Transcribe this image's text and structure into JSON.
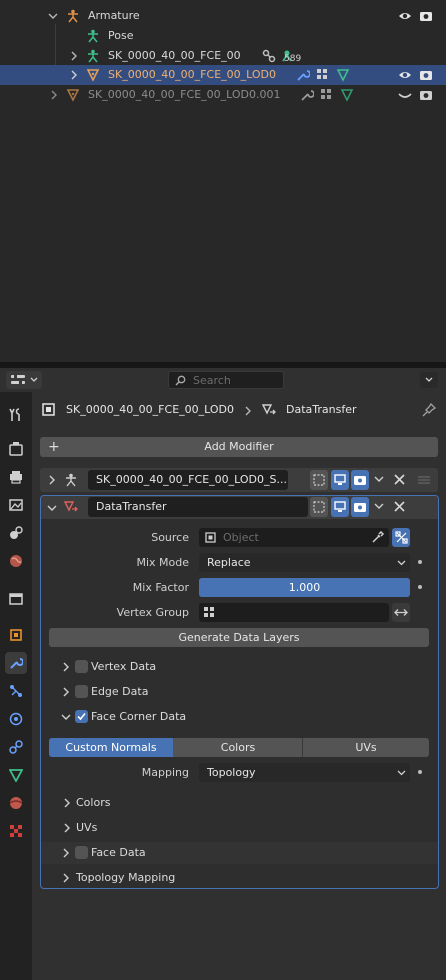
{
  "outliner": {
    "rows": [
      {
        "label": "Armature"
      },
      {
        "label": "Pose"
      },
      {
        "label": "SK_0000_40_00_FCE_00",
        "badge": "589"
      },
      {
        "label": "SK_0000_40_00_FCE_00_LOD0"
      },
      {
        "label": "SK_0000_40_00_FCE_00_LOD0.001"
      }
    ]
  },
  "header": {
    "search_placeholder": "Search"
  },
  "breadcrumb": {
    "object": "SK_0000_40_00_FCE_00_LOD0",
    "modifier": "DataTransfer"
  },
  "add_modifier": "Add Modifier",
  "modifiers": {
    "first": {
      "name": "SK_0000_40_00_FCE_00_LOD0_S..."
    },
    "second": {
      "name": "DataTransfer"
    }
  },
  "data_transfer": {
    "source_label": "Source",
    "source_placeholder": "Object",
    "mix_mode_label": "Mix Mode",
    "mix_mode_value": "Replace",
    "mix_factor_label": "Mix Factor",
    "mix_factor_value": "1.000",
    "mix_factor_fraction": 1.0,
    "vertex_group_label": "Vertex Group",
    "generate_button": "Generate Data Layers",
    "sections": {
      "vertex_data": "Vertex Data",
      "edge_data": "Edge Data",
      "face_corner_data": "Face Corner Data",
      "face_data": "Face Data",
      "topology_mapping": "Topology Mapping"
    },
    "face_corner": {
      "tabs": [
        "Custom Normals",
        "Colors",
        "UVs"
      ],
      "active_tab": "Custom Normals",
      "mapping_label": "Mapping",
      "mapping_value": "Topology",
      "subpanels": [
        "Colors",
        "UVs"
      ]
    }
  },
  "colors": {
    "accent": "#4772b3",
    "selection": "#334d80",
    "armature": "#e0924a",
    "mesh": "#e5a05a",
    "data_green": "#3fbf8a"
  }
}
